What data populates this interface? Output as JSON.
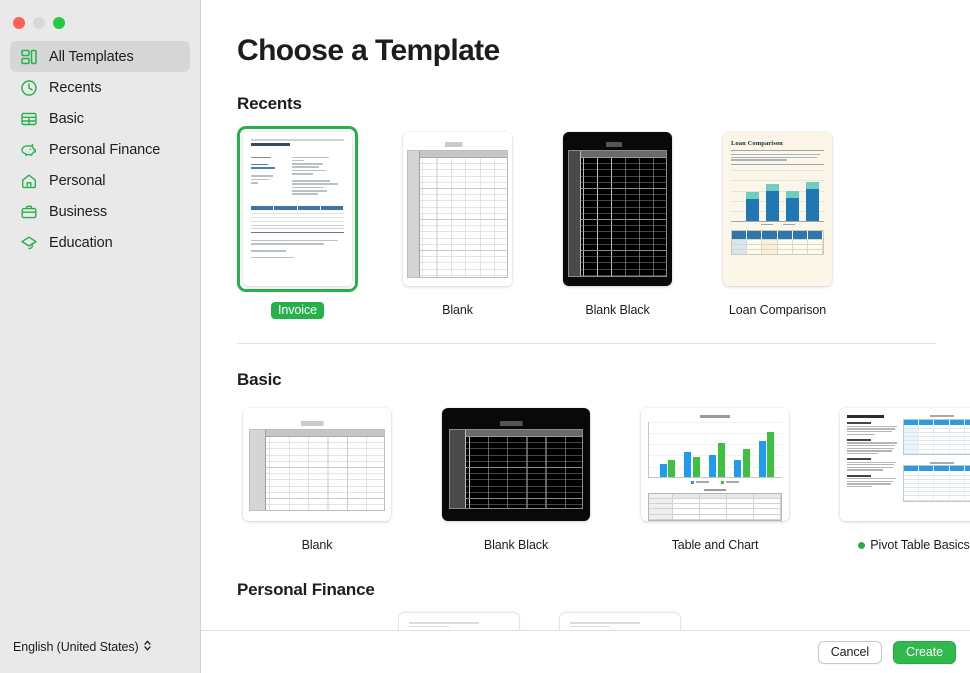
{
  "window": {
    "traffic_lights": [
      "close",
      "minimize",
      "maximize"
    ]
  },
  "sidebar": {
    "items": [
      {
        "label": "All Templates",
        "icon": "templates-grid-icon",
        "selected": true
      },
      {
        "label": "Recents",
        "icon": "clock-icon",
        "selected": false
      },
      {
        "label": "Basic",
        "icon": "table-grid-icon",
        "selected": false
      },
      {
        "label": "Personal Finance",
        "icon": "piggy-bank-icon",
        "selected": false
      },
      {
        "label": "Personal",
        "icon": "home-icon",
        "selected": false
      },
      {
        "label": "Business",
        "icon": "briefcase-icon",
        "selected": false
      },
      {
        "label": "Education",
        "icon": "graduation-cap-icon",
        "selected": false
      }
    ],
    "language": {
      "value": "English (United States)",
      "chevron": "⌃⌄"
    }
  },
  "main": {
    "title": "Choose a Template",
    "sections": [
      {
        "heading": "Recents",
        "templates": [
          {
            "label": "Invoice",
            "art": "invoice",
            "selected": true,
            "new": false
          },
          {
            "label": "Blank",
            "art": "blank",
            "selected": false,
            "new": false
          },
          {
            "label": "Blank Black",
            "art": "blank-black",
            "selected": false,
            "new": false
          },
          {
            "label": "Loan Comparison",
            "art": "loan",
            "selected": false,
            "new": false
          }
        ]
      },
      {
        "heading": "Basic",
        "templates": [
          {
            "label": "Blank",
            "art": "blank",
            "selected": false,
            "new": false
          },
          {
            "label": "Blank Black",
            "art": "blank-black",
            "selected": false,
            "new": false
          },
          {
            "label": "Table and Chart",
            "art": "chart",
            "selected": false,
            "new": false
          },
          {
            "label": "Pivot Table Basics",
            "art": "pivot",
            "selected": false,
            "new": true
          },
          {
            "label": "",
            "art": "pivot",
            "selected": false,
            "new": false
          }
        ]
      },
      {
        "heading": "Personal Finance",
        "templates": []
      }
    ]
  },
  "footer": {
    "cancel_label": "Cancel",
    "create_label": "Create"
  },
  "colors": {
    "accent_green": "#30b94d",
    "selection_green": "#26b14c",
    "sidebar_bg": "#e9e9e9",
    "sidebar_selected_bg": "#d6d6d6",
    "traffic_close": "#ff5f57",
    "traffic_min": "#d8d8d8",
    "traffic_max": "#28c840"
  }
}
